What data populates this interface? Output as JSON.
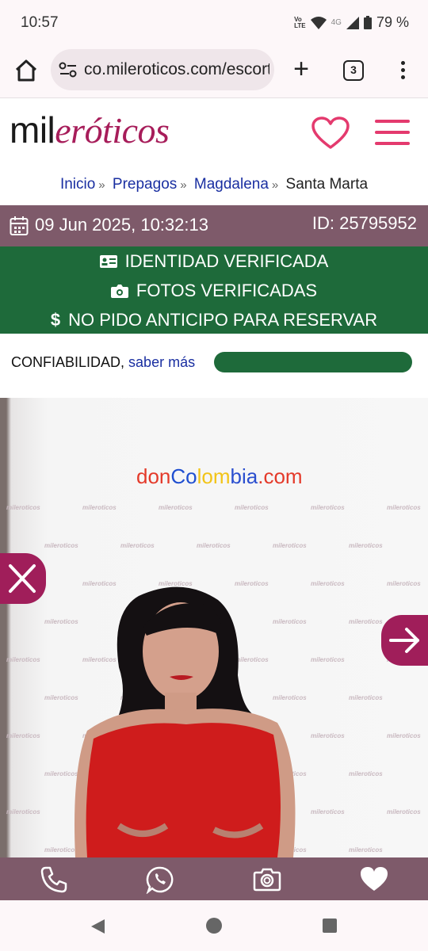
{
  "status": {
    "time": "10:57",
    "net": "4G",
    "volte": "Vo\nLTE",
    "battery": "79 %"
  },
  "browser": {
    "url": "co.mileroticos.com/escorts",
    "tab_count": "3",
    "new_tab": "+"
  },
  "site": {
    "logo_a": "mil",
    "logo_b": "eróticos",
    "accent": "#e43a6e",
    "brand": "#a71d5a"
  },
  "breadcrumb": {
    "items": [
      "Inicio",
      "Prepagos",
      "Magdalena"
    ],
    "current": "Santa Marta",
    "sep": "»"
  },
  "listing": {
    "date": "09 Jun 2025, 10:32:13",
    "id": "ID: 25795952",
    "verified": [
      {
        "icon": "id-card-icon",
        "text": "IDENTIDAD VERIFICADA"
      },
      {
        "icon": "camera-icon",
        "text": "FOTOS VERIFICADAS"
      },
      {
        "icon": "dollar-icon",
        "text": "NO PIDO ANTICIPO PARA RESERVAR"
      }
    ],
    "trust_label": "CONFIABILIDAD,",
    "trust_link": "saber más",
    "trust_level": 1.0
  },
  "photo": {
    "watermark": "mileroticos",
    "brandmark": [
      "don",
      "Co",
      "lom",
      "bia",
      ".com"
    ]
  },
  "colors": {
    "green": "#1e6a3a",
    "mauve": "#7e5a6a",
    "magenta": "#a01e5a"
  }
}
